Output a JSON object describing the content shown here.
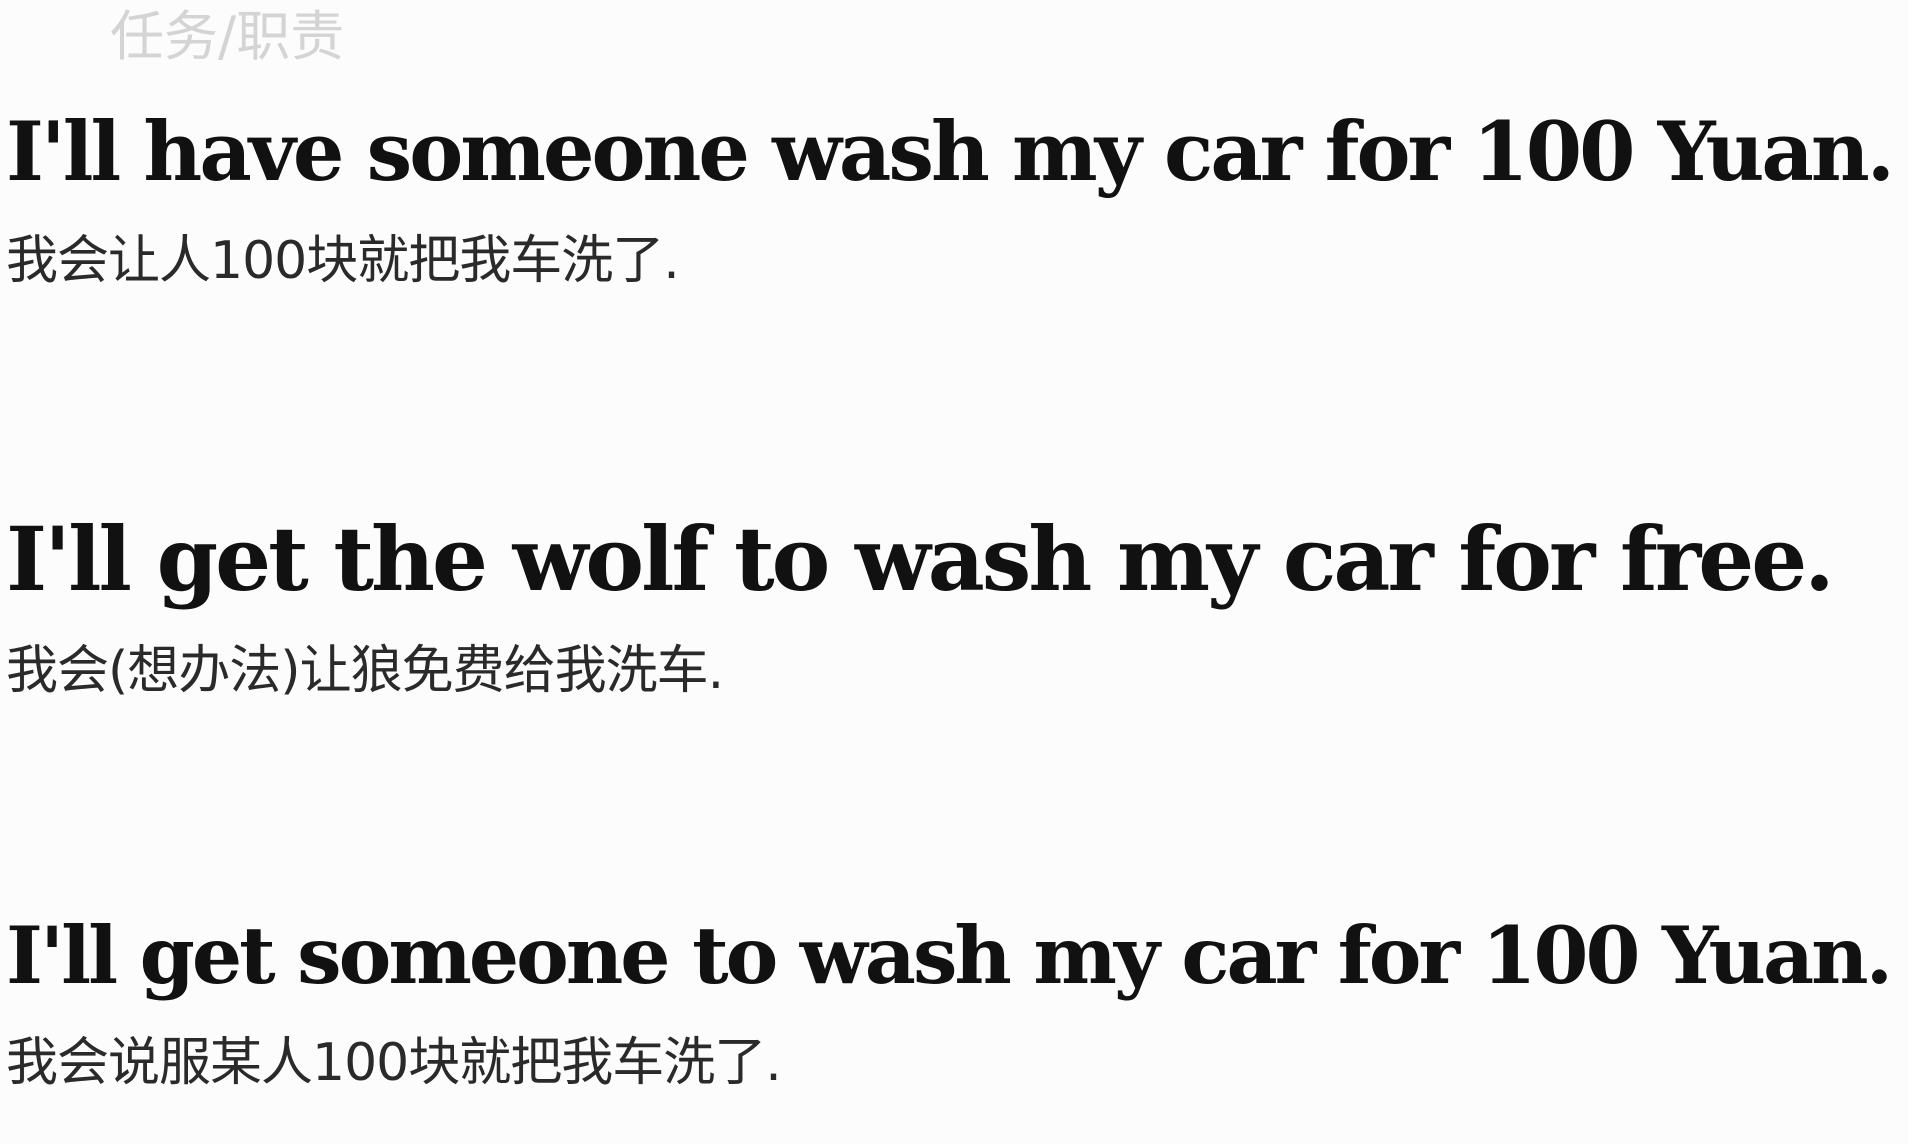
{
  "header": {
    "watermark": "任务/职责"
  },
  "examples": [
    {
      "english": "I'll have someone wash my car for 100 Yuan.",
      "chinese": "我会让人100块就把我车洗了."
    },
    {
      "english": "I'll get the wolf to wash my car for free.",
      "chinese": "我会(想办法)让狼免费给我洗车."
    },
    {
      "english": "I'll get someone to wash my car for 100 Yuan.",
      "chinese": "我会说服某人100块就把我车洗了."
    }
  ]
}
